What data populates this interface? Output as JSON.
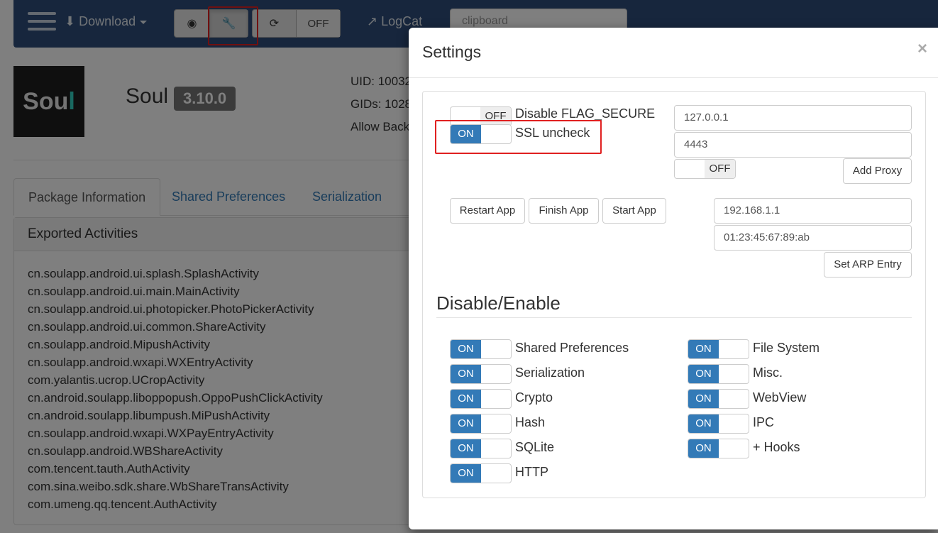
{
  "navbar": {
    "download_label": "Download",
    "off_label": "OFF",
    "logcat_label": "LogCat",
    "search_placeholder": "clipboard"
  },
  "app": {
    "name": "Soul",
    "version": "3.10.0",
    "logo_text_main": "Sou",
    "logo_text_accent": "l",
    "uid": "UID: 10032",
    "gids": "GIDs: 1028",
    "allow_backup": "Allow Back"
  },
  "tabs": [
    "Package Information",
    "Shared Preferences",
    "Serialization"
  ],
  "panel": {
    "title": "Exported Activities",
    "activities": [
      "cn.soulapp.android.ui.splash.SplashActivity",
      "cn.soulapp.android.ui.main.MainActivity",
      "cn.soulapp.android.ui.photopicker.PhotoPickerActivity",
      "cn.soulapp.android.ui.common.ShareActivity",
      "cn.soulapp.android.MipushActivity",
      "cn.soulapp.android.wxapi.WXEntryActivity",
      "com.yalantis.ucrop.UCropActivity",
      "cn.android.soulapp.liboppopush.OppoPushClickActivity",
      "cn.android.soulapp.libumpush.MiPushActivity",
      "cn.soulapp.android.wxapi.WXPayEntryActivity",
      "cn.soulapp.android.WBShareActivity",
      "com.tencent.tauth.AuthActivity",
      "com.sina.weibo.sdk.share.WbShareTransActivity",
      "com.umeng.qq.tencent.AuthActivity"
    ]
  },
  "modal": {
    "title": "Settings",
    "close": "×",
    "on_label": "ON",
    "off_label": "OFF",
    "flag_secure_label": "Disable FLAG_SECURE",
    "ssl_label": "SSL uncheck",
    "proxy_host": "127.0.0.1",
    "proxy_port": "4443",
    "add_proxy": "Add Proxy",
    "restart_app": "Restart App",
    "finish_app": "Finish App",
    "start_app": "Start App",
    "arp_ip": "192.168.1.1",
    "arp_mac": "01:23:45:67:89:ab",
    "set_arp": "Set ARP Entry",
    "section_title": "Disable/Enable",
    "left_toggles": [
      "Shared Preferences",
      "Serialization",
      "Crypto",
      "Hash",
      "SQLite",
      "HTTP"
    ],
    "right_toggles": [
      "File System",
      "Misc.",
      "WebView",
      "IPC",
      "+ Hooks"
    ]
  },
  "colors": {
    "navbar": "#2e4d7b",
    "toggle_on": "#337ab7",
    "highlight": "#e02020"
  }
}
